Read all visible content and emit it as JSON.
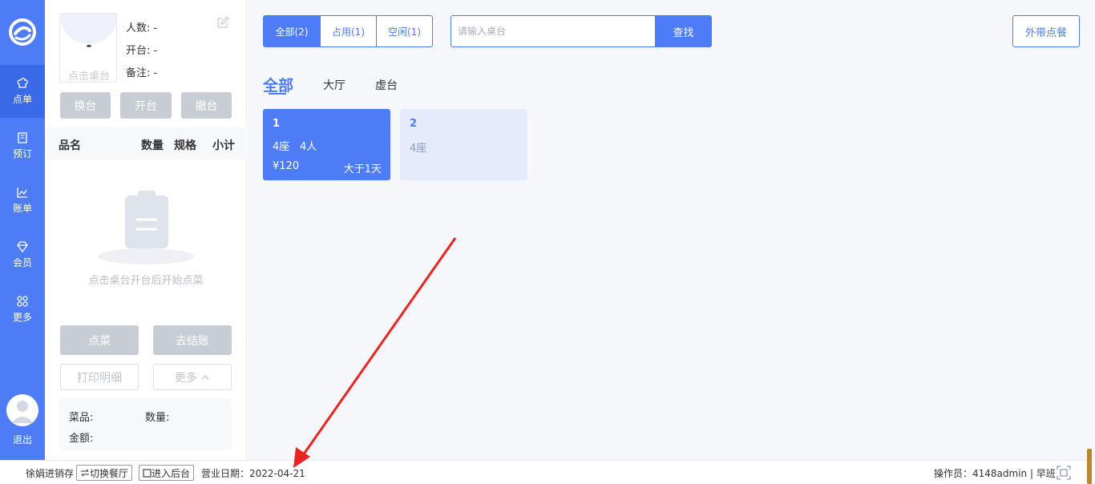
{
  "nav": {
    "items": [
      {
        "label": "点单",
        "icon": "chef-hat-icon"
      },
      {
        "label": "预订",
        "icon": "book-icon"
      },
      {
        "label": "账单",
        "icon": "chart-icon"
      },
      {
        "label": "会员",
        "icon": "diamond-icon"
      },
      {
        "label": "更多",
        "icon": "grid-icon"
      }
    ],
    "logout": "退出"
  },
  "panel": {
    "table_pic_value": "-",
    "table_pic_hint": "点击桌台",
    "people": "人数:  -",
    "open": "开台:  -",
    "remark": "备注:  -",
    "btn_change": "换台",
    "btn_open": "开台",
    "btn_cancel": "撤台",
    "col_name": "品名",
    "col_qty": "数量",
    "col_spec": "规格",
    "col_subtotal": "小计",
    "empty_text": "点击桌台开台后开始点菜",
    "btn_order": "点菜",
    "btn_checkout": "去结账",
    "btn_print": "打印明细",
    "btn_more": "更多",
    "summary_dish": "菜品:",
    "summary_qty": "数量:",
    "summary_amount": "金额:"
  },
  "main": {
    "filters": [
      "全部(2)",
      "占用(1)",
      "空闲(1)"
    ],
    "search_placeholder": "请输入桌台",
    "search_btn": "查找",
    "takeout_btn": "外带点餐",
    "area_tabs": [
      "全部",
      "大厅",
      "虚台"
    ],
    "tables": [
      {
        "name": "1",
        "seats": "4座",
        "people": "4人",
        "amount": "¥120",
        "duration": "大于1天",
        "status": "occupied"
      },
      {
        "name": "2",
        "seats": "4座",
        "status": "free"
      }
    ]
  },
  "footer": {
    "store": "徐娟进销存",
    "switch_btn": "切换餐厅",
    "backend_btn": "进入后台",
    "business_date": "营业日期：2022-04-21",
    "operator": "操作员：4148admin | 早班"
  },
  "colors": {
    "accent": "#4d7cf6",
    "annotation_arrow": "#e8261f"
  }
}
